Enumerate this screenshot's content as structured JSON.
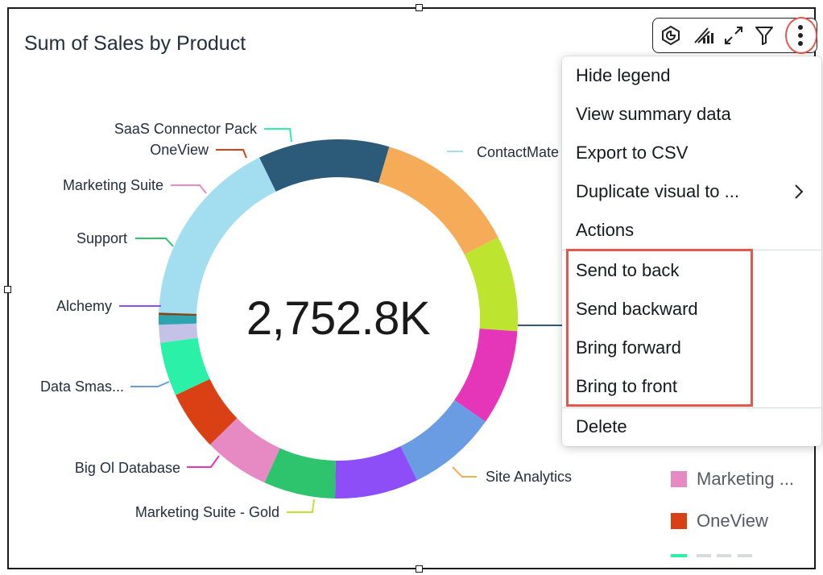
{
  "visual": {
    "title": "Sum of Sales by Product",
    "center_value": "2,752.8K"
  },
  "toolbar": {
    "icons": [
      "insight-icon",
      "forecast-icon",
      "expand-icon",
      "filter-icon",
      "more-options-icon"
    ]
  },
  "menu": {
    "items": [
      {
        "label": "Hide legend"
      },
      {
        "label": "View summary data"
      },
      {
        "label": "Export to CSV"
      },
      {
        "label": "Duplicate visual to ...",
        "submenu": true
      },
      {
        "label": "Actions"
      },
      {
        "label": "Send to back"
      },
      {
        "label": "Send backward"
      },
      {
        "label": "Bring forward"
      },
      {
        "label": "Bring to front"
      },
      {
        "label": "Delete"
      }
    ]
  },
  "legend": {
    "items": [
      {
        "label": "Marketing ...",
        "color": "#e78ac3"
      },
      {
        "label": "OneView",
        "color": "#d94114"
      }
    ],
    "partial_color": "#2bf0a8"
  },
  "chart_data": {
    "type": "pie",
    "title": "Sum of Sales by Product",
    "total_label": "2,752.8K",
    "slices": [
      {
        "label": "ContactMate",
        "value": 0.16,
        "color": "#a2def0"
      },
      {
        "label": "",
        "value": 0.11,
        "color": "#2b5b78"
      },
      {
        "label": "Site Analytics",
        "value": 0.12,
        "color": "#f5ab58"
      },
      {
        "label": "Marketing Suite - Gold",
        "value": 0.08,
        "color": "#bde42e"
      },
      {
        "label": "Big Ol Database",
        "value": 0.08,
        "color": "#e535b8"
      },
      {
        "label": "Data Smas...",
        "value": 0.075,
        "color": "#6a9ce3"
      },
      {
        "label": "Alchemy",
        "value": 0.07,
        "color": "#8e4ef7"
      },
      {
        "label": "Support",
        "value": 0.06,
        "color": "#2ec46e"
      },
      {
        "label": "Marketing Suite",
        "value": 0.055,
        "color": "#e78ac3"
      },
      {
        "label": "OneView",
        "value": 0.05,
        "color": "#d94114"
      },
      {
        "label": "SaaS Connector Pack",
        "value": 0.045,
        "color": "#2bf0a8"
      },
      {
        "label": "",
        "value": 0.015,
        "color": "#c5c2e8"
      },
      {
        "label": "",
        "value": 0.008,
        "color": "#2ea4b0"
      },
      {
        "label": "",
        "value": 0.002,
        "color": "#7a4a1e"
      }
    ]
  }
}
